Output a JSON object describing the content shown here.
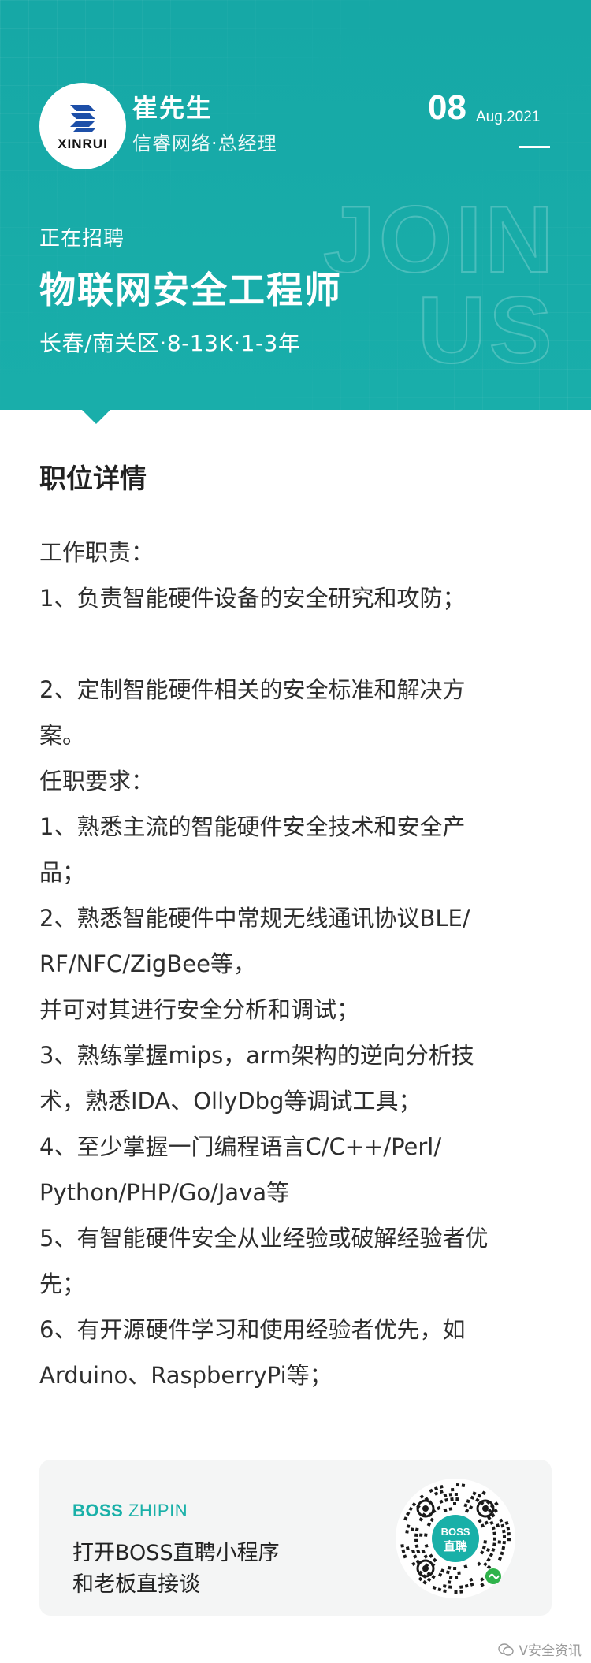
{
  "header": {
    "logo_text": "XINRUI",
    "recruiter_name": "崔先生",
    "recruiter_title": "信睿网络·总经理",
    "date_day": "08",
    "date_month_year": "Aug.2021",
    "recruiting_label": "正在招聘",
    "job_title": "物联网安全工程师",
    "job_meta": "长春/南关区·8-13K·1-3年",
    "watermark_text": "JOIN US",
    "accent_color": "#19aeaa"
  },
  "details": {
    "section_title": "职位详情",
    "lines": [
      "工作职责：",
      "1、负责智能硬件设备的安全研究和攻防；",
      "",
      "2、定制智能硬件相关的安全标准和解决方",
      "案。",
      "任职要求：",
      "1、熟悉主流的智能硬件安全技术和安全产",
      "品；",
      "2、熟悉智能硬件中常规无线通讯协议BLE/",
      "RF/NFC/ZigBee等，",
      "并可对其进行安全分析和调试；",
      "3、熟练掌握mips，arm架构的逆向分析技",
      "术，熟悉IDA、OllyDbg等调试工具；",
      "4、至少掌握一门编程语言C/C++/Perl/",
      "Python/PHP/Go/Java等",
      "5、有智能硬件安全从业经验或破解经验者优",
      "先；",
      "6、有开源硬件学习和使用经验者优先，如",
      "Arduino、RaspberryPi等；"
    ]
  },
  "boss_card": {
    "brand_bold": "BOSS",
    "brand_thin": "ZHIPIN",
    "line1": "打开BOSS直聘小程序",
    "line2": "和老板直接谈",
    "qr_center_top": "BOSS",
    "qr_center_bottom": "直聘",
    "brand_color": "#19b0a8"
  },
  "footer": {
    "watermark": "V安全资讯"
  }
}
